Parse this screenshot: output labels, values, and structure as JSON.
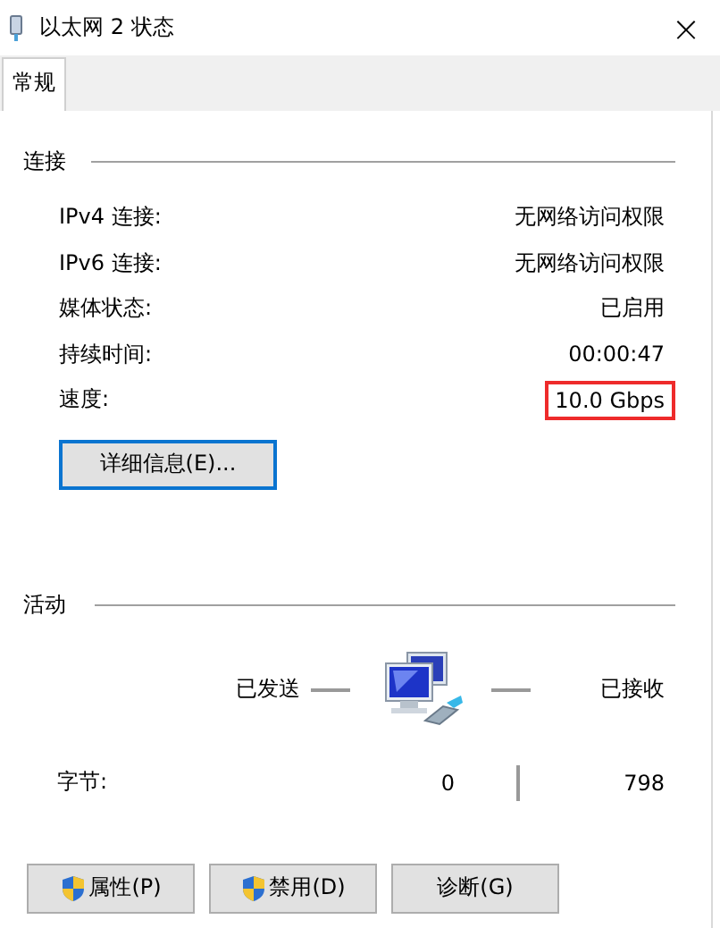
{
  "window": {
    "title": "以太网 2 状态",
    "close": "×"
  },
  "tabs": [
    {
      "label": "常规",
      "selected": true
    }
  ],
  "connection": {
    "heading": "连接",
    "rows": [
      {
        "label": "IPv4 连接:",
        "value": "无网络访问权限",
        "highlighted": false
      },
      {
        "label": "IPv6 连接:",
        "value": "无网络访问权限",
        "highlighted": false
      },
      {
        "label": "媒体状态:",
        "value": "已启用",
        "highlighted": false
      },
      {
        "label": "持续时间:",
        "value": "00:00:47",
        "highlighted": false
      },
      {
        "label": "速度:",
        "value": "10.0 Gbps",
        "highlighted": true
      }
    ],
    "details_button": "详细信息(E)..."
  },
  "activity": {
    "heading": "活动",
    "sent_label": "已发送",
    "received_label": "已接收",
    "bytes_label": "字节:",
    "bytes_sent": "0",
    "bytes_received": "798"
  },
  "buttons": [
    {
      "label": "属性(P)",
      "shield": true
    },
    {
      "label": "禁用(D)",
      "shield": true
    },
    {
      "label": "诊断(G)",
      "shield": false
    }
  ]
}
